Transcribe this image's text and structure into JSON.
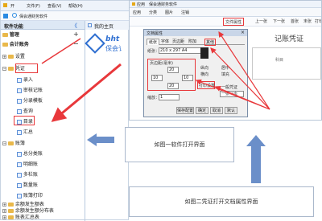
{
  "left_app": {
    "menu_items": [
      "文件(F)",
      "查看(V)",
      "帮助(H)"
    ],
    "open_menu": "开",
    "app_tab": "保会通财务软件",
    "sidebar_title": "软件功能",
    "collapse_glyph": "《",
    "home_tab": "我的主页",
    "logo_text_en": "bht",
    "logo_text_cn": "保会讠",
    "tree": [
      {
        "label": "管理",
        "level": 0,
        "icon": "folder",
        "tog": "+"
      },
      {
        "label": "会计账务",
        "level": 0,
        "icon": "folder",
        "tog": "−"
      },
      {
        "label": "设置",
        "level": 1,
        "icon": "folder",
        "exp": "+"
      },
      {
        "label": "凭证",
        "level": 1,
        "icon": "folder",
        "exp": "−"
      },
      {
        "label": "录入",
        "level": 2,
        "icon": "page"
      },
      {
        "label": "审核记账",
        "level": 2,
        "icon": "page"
      },
      {
        "label": "分录模板",
        "level": 2,
        "icon": "page"
      },
      {
        "label": "查询",
        "level": 2,
        "icon": "page"
      },
      {
        "label": "目录",
        "level": 2,
        "icon": "page"
      },
      {
        "label": "汇总",
        "level": 2,
        "icon": "page"
      },
      {
        "label": "账簿",
        "level": 1,
        "icon": "folder",
        "exp": "−"
      },
      {
        "label": "总分类账",
        "level": 2,
        "icon": "page"
      },
      {
        "label": "明细账",
        "level": 2,
        "icon": "page"
      },
      {
        "label": "多栏账",
        "level": 2,
        "icon": "page"
      },
      {
        "label": "数量账",
        "level": 2,
        "icon": "page"
      },
      {
        "label": "账簿打印",
        "level": 2,
        "icon": "page"
      },
      {
        "label": "余额发生额表",
        "level": 1,
        "icon": "folder",
        "exp": "+"
      },
      {
        "label": "余额发生额分布表",
        "level": 1,
        "icon": "folder",
        "exp": "+"
      },
      {
        "label": "账表汇总表",
        "level": 1,
        "icon": "folder",
        "exp": "+"
      }
    ]
  },
  "right_app": {
    "menu_items": [
      "应用",
      "保会通财务软件"
    ],
    "tabs": [
      "应用",
      "分类",
      "图片",
      "注销"
    ],
    "toolbar": [
      "文件属性",
      "上一张",
      "下一张",
      "首张",
      "末张",
      "打印"
    ],
    "voucher_title": "记账凭证",
    "voucher_field": "科目",
    "dialog": {
      "title": "文档属性",
      "tabs": [
        "纸张",
        "字体",
        "页边距",
        "附加",
        "其他"
      ],
      "paper_label": "纸张：",
      "paper_value": "210 x 297 A4",
      "group_label": "页边距(毫米)",
      "margin_top": "20",
      "margin_left": "10",
      "margin_right": "10",
      "margin_bottom": "20",
      "zoom_label": "缩放：",
      "zoom_value": "1",
      "center_label": "居中",
      "orientation_options": [
        "纵向",
        "横向"
      ],
      "fill_label": "填充",
      "print_label": "打印设置",
      "format_label": "一般凭证",
      "format_option": "一张一页",
      "save_label": "保存配置",
      "ok": "确定",
      "cancel": "取消",
      "default": "默认"
    }
  },
  "captions": {
    "one": "如图一软件打开界面",
    "two": "如图二凭证打开文档属性界面"
  },
  "colors": {
    "highlight_red": "#e8383b",
    "arrow_blue": "#6b8fc9",
    "accent_blue": "#2f6fd1"
  }
}
